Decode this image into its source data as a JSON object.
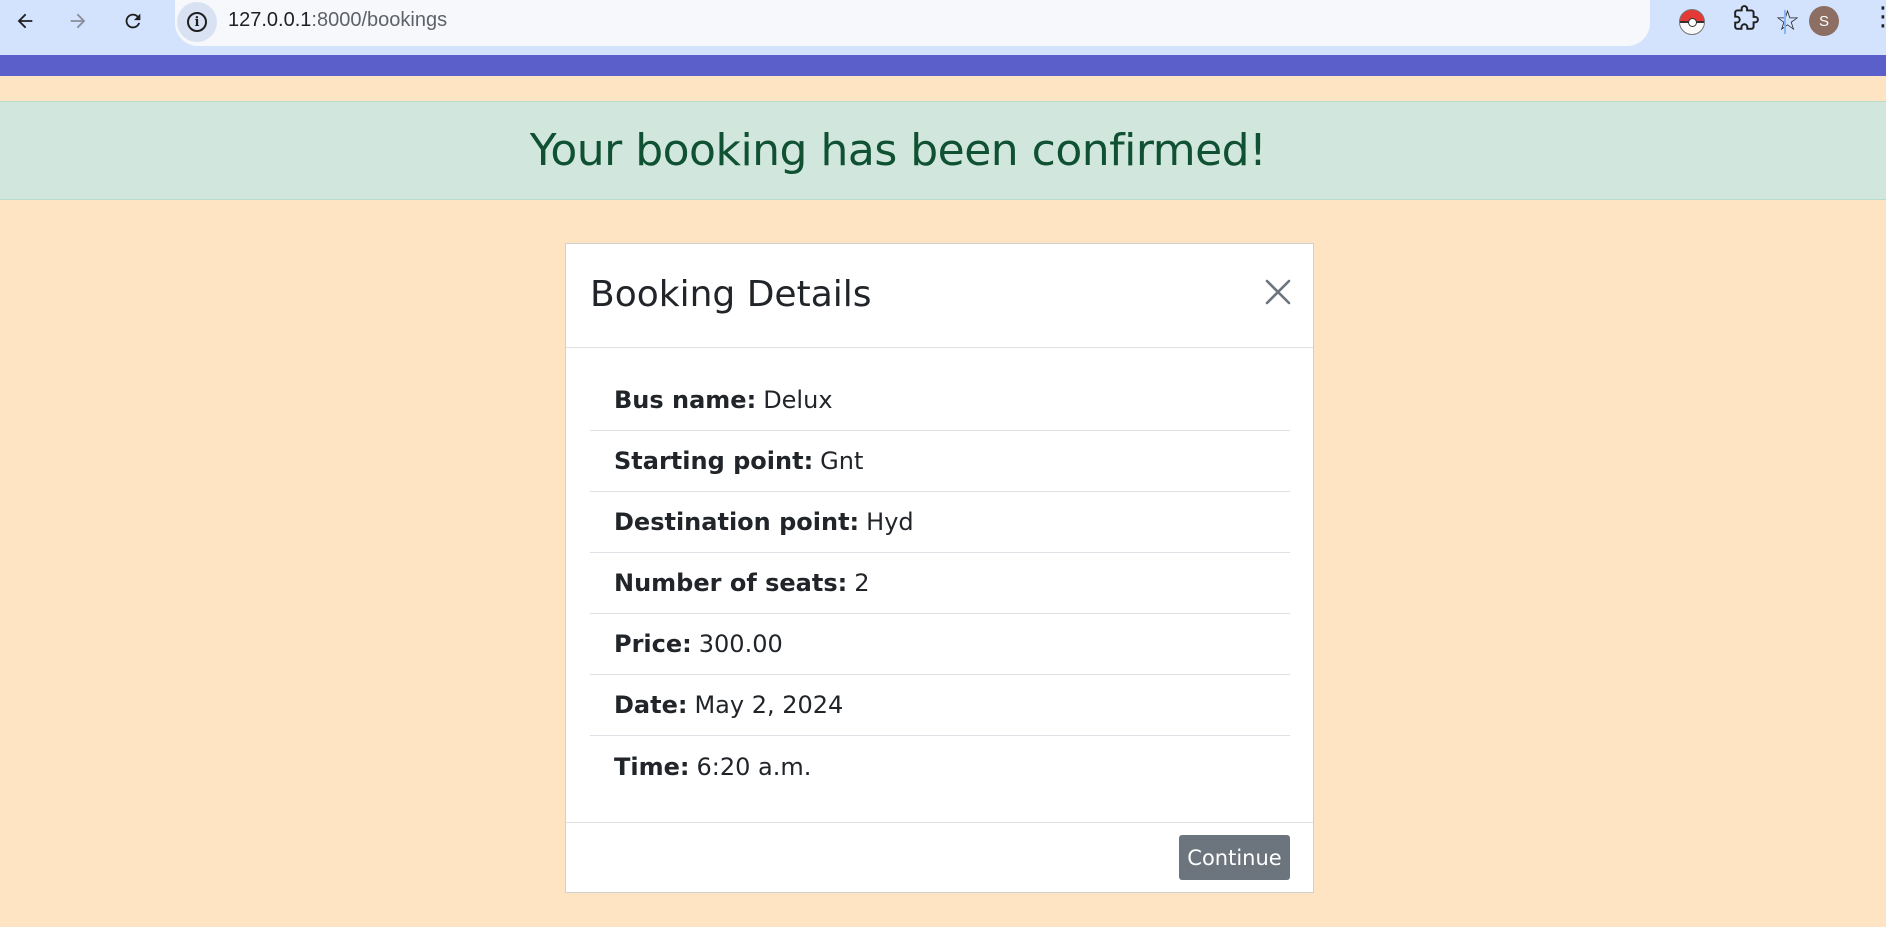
{
  "browser": {
    "url_host": "127.0.0.1",
    "url_path": ":8000/bookings",
    "avatar_initial": "S",
    "icons": [
      "back-arrow-icon",
      "forward-arrow-icon",
      "reload-icon",
      "info-icon",
      "star-icon",
      "pokeball-extension-icon",
      "puzzle-extension-icon",
      "more-vert-icon"
    ]
  },
  "colors": {
    "page_background": "#ffe4c4",
    "nav_strip": "#5a5fc9",
    "alert_background": "#d1e7dd",
    "alert_text": "#0f5132",
    "button_secondary": "#6c757d"
  },
  "alert": {
    "message": "Your booking has been confirmed!"
  },
  "modal": {
    "title": "Booking Details",
    "close_icon": "close-icon",
    "details": [
      {
        "label": "Bus name:",
        "value": "Delux"
      },
      {
        "label": "Starting point:",
        "value": "Gnt"
      },
      {
        "label": "Destination point:",
        "value": "Hyd"
      },
      {
        "label": "Number of seats:",
        "value": "2"
      },
      {
        "label": "Price:",
        "value": "300.00"
      },
      {
        "label": "Date:",
        "value": "May 2, 2024"
      },
      {
        "label": "Time:",
        "value": "6:20 a.m."
      }
    ],
    "continue_label": "Continue"
  }
}
